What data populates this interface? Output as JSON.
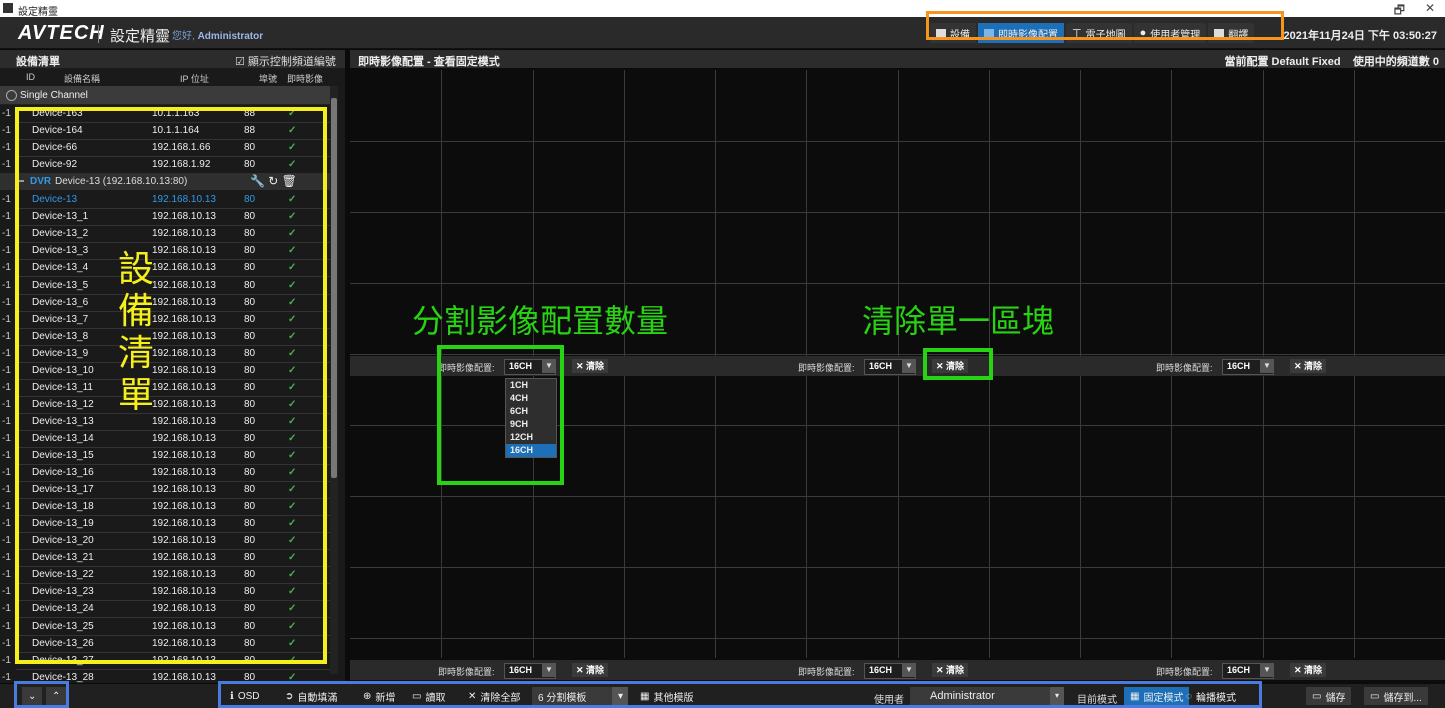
{
  "window": {
    "title": "設定精靈",
    "controls": {
      "restore": "🗗",
      "close": "✕"
    }
  },
  "header": {
    "logo": "AVTECH",
    "app_name": "設定精靈",
    "greeting_prefix": "您好,",
    "user": "Administrator",
    "nav": [
      {
        "label": "設備",
        "icon": "monitor-icon",
        "active": false
      },
      {
        "label": "即時影像配置",
        "icon": "grid-icon",
        "active": true
      },
      {
        "label": "電子地圖",
        "icon": "pin-icon",
        "active": false
      },
      {
        "label": "使用者管理",
        "icon": "user-icon",
        "active": false
      },
      {
        "label": "翻譯",
        "icon": "translate-icon",
        "active": false
      }
    ],
    "datetime": "2021年11月24日 下午 03:50:27"
  },
  "device_list": {
    "title": "設備清單",
    "show_channel_label": "☑ 顯示控制頻道編號",
    "columns": {
      "id": "ID",
      "name": "設備名稱",
      "ip": "IP 位址",
      "port": "埠號",
      "live": "即時影像"
    },
    "single_channel_label": "Single Channel",
    "single": [
      {
        "id": "-1",
        "name": "Device-163",
        "ip": "10.1.1.163",
        "port": "88",
        "live": "✓"
      },
      {
        "id": "-1",
        "name": "Device-164",
        "ip": "10.1.1.164",
        "port": "88",
        "live": "✓"
      },
      {
        "id": "-1",
        "name": "Device-66",
        "ip": "192.168.1.66",
        "port": "80",
        "live": "✓"
      },
      {
        "id": "-1",
        "name": "Device-92",
        "ip": "192.168.1.92",
        "port": "80",
        "live": "✓"
      }
    ],
    "dvr": {
      "type": "DVR",
      "info": "Device-13  (192.168.10.13:80)",
      "tools": "🔧 ↻ 🗑"
    },
    "dvr_rows": [
      {
        "id": "-1",
        "name": "Device-13",
        "ip": "192.168.10.13",
        "port": "80",
        "live": "✓"
      },
      {
        "id": "-1",
        "name": "Device-13_1",
        "ip": "192.168.10.13",
        "port": "80",
        "live": "✓"
      },
      {
        "id": "-1",
        "name": "Device-13_2",
        "ip": "192.168.10.13",
        "port": "80",
        "live": "✓"
      },
      {
        "id": "-1",
        "name": "Device-13_3",
        "ip": "192.168.10.13",
        "port": "80",
        "live": "✓"
      },
      {
        "id": "-1",
        "name": "Device-13_4",
        "ip": "192.168.10.13",
        "port": "80",
        "live": "✓"
      },
      {
        "id": "-1",
        "name": "Device-13_5",
        "ip": "192.168.10.13",
        "port": "80",
        "live": "✓"
      },
      {
        "id": "-1",
        "name": "Device-13_6",
        "ip": "192.168.10.13",
        "port": "80",
        "live": "✓"
      },
      {
        "id": "-1",
        "name": "Device-13_7",
        "ip": "192.168.10.13",
        "port": "80",
        "live": "✓"
      },
      {
        "id": "-1",
        "name": "Device-13_8",
        "ip": "192.168.10.13",
        "port": "80",
        "live": "✓"
      },
      {
        "id": "-1",
        "name": "Device-13_9",
        "ip": "192.168.10.13",
        "port": "80",
        "live": "✓"
      },
      {
        "id": "-1",
        "name": "Device-13_10",
        "ip": "192.168.10.13",
        "port": "80",
        "live": "✓"
      },
      {
        "id": "-1",
        "name": "Device-13_11",
        "ip": "192.168.10.13",
        "port": "80",
        "live": "✓"
      },
      {
        "id": "-1",
        "name": "Device-13_12",
        "ip": "192.168.10.13",
        "port": "80",
        "live": "✓"
      },
      {
        "id": "-1",
        "name": "Device-13_13",
        "ip": "192.168.10.13",
        "port": "80",
        "live": "✓"
      },
      {
        "id": "-1",
        "name": "Device-13_14",
        "ip": "192.168.10.13",
        "port": "80",
        "live": "✓"
      },
      {
        "id": "-1",
        "name": "Device-13_15",
        "ip": "192.168.10.13",
        "port": "80",
        "live": "✓"
      },
      {
        "id": "-1",
        "name": "Device-13_16",
        "ip": "192.168.10.13",
        "port": "80",
        "live": "✓"
      },
      {
        "id": "-1",
        "name": "Device-13_17",
        "ip": "192.168.10.13",
        "port": "80",
        "live": "✓"
      },
      {
        "id": "-1",
        "name": "Device-13_18",
        "ip": "192.168.10.13",
        "port": "80",
        "live": "✓"
      },
      {
        "id": "-1",
        "name": "Device-13_19",
        "ip": "192.168.10.13",
        "port": "80",
        "live": "✓"
      },
      {
        "id": "-1",
        "name": "Device-13_20",
        "ip": "192.168.10.13",
        "port": "80",
        "live": "✓"
      },
      {
        "id": "-1",
        "name": "Device-13_21",
        "ip": "192.168.10.13",
        "port": "80",
        "live": "✓"
      },
      {
        "id": "-1",
        "name": "Device-13_22",
        "ip": "192.168.10.13",
        "port": "80",
        "live": "✓"
      },
      {
        "id": "-1",
        "name": "Device-13_23",
        "ip": "192.168.10.13",
        "port": "80",
        "live": "✓"
      },
      {
        "id": "-1",
        "name": "Device-13_24",
        "ip": "192.168.10.13",
        "port": "80",
        "live": "✓"
      },
      {
        "id": "-1",
        "name": "Device-13_25",
        "ip": "192.168.10.13",
        "port": "80",
        "live": "✓"
      },
      {
        "id": "-1",
        "name": "Device-13_26",
        "ip": "192.168.10.13",
        "port": "80",
        "live": "✓"
      },
      {
        "id": "-1",
        "name": "Device-13_27",
        "ip": "192.168.10.13",
        "port": "80",
        "live": "✓"
      },
      {
        "id": "-1",
        "name": "Device-13_28",
        "ip": "192.168.10.13",
        "port": "80",
        "live": "✓"
      }
    ],
    "annotation": [
      "設",
      "備",
      "清",
      "單"
    ]
  },
  "live": {
    "title": "即時影像配置 - 查看固定模式",
    "current_label": "當前配置 Default Fixed",
    "channels_used_label": "使用中的頻道數 0",
    "config_label": "即時影像配置:",
    "config_value": "16CH",
    "clear_label": "清除",
    "dropdown_options": [
      "1CH",
      "4CH",
      "6CH",
      "9CH",
      "12CH",
      "16CH"
    ],
    "dropdown_selected": "16CH",
    "annotation_split": "分割影像配置數量",
    "annotation_clear": "清除單一區塊"
  },
  "footer": {
    "osd": "OSD",
    "auto_fill": "自動填滿",
    "add": "新增",
    "load": "讀取",
    "clear_all": "清除全部",
    "template_value": "6 分割模板",
    "other_template": "其他模版",
    "user_label": "使用者",
    "user_value": "Administrator",
    "mode_label": "目前模式",
    "fixed_mode": "固定模式",
    "rotate_mode": "輪播模式",
    "save": "儲存",
    "save_as": "儲存到..."
  },
  "colors": {
    "accent": "#1d6fb7",
    "orange": "#f7941d",
    "yellow": "#f5ef1a",
    "green": "#27d312",
    "blue_frame": "#4a7be0"
  }
}
